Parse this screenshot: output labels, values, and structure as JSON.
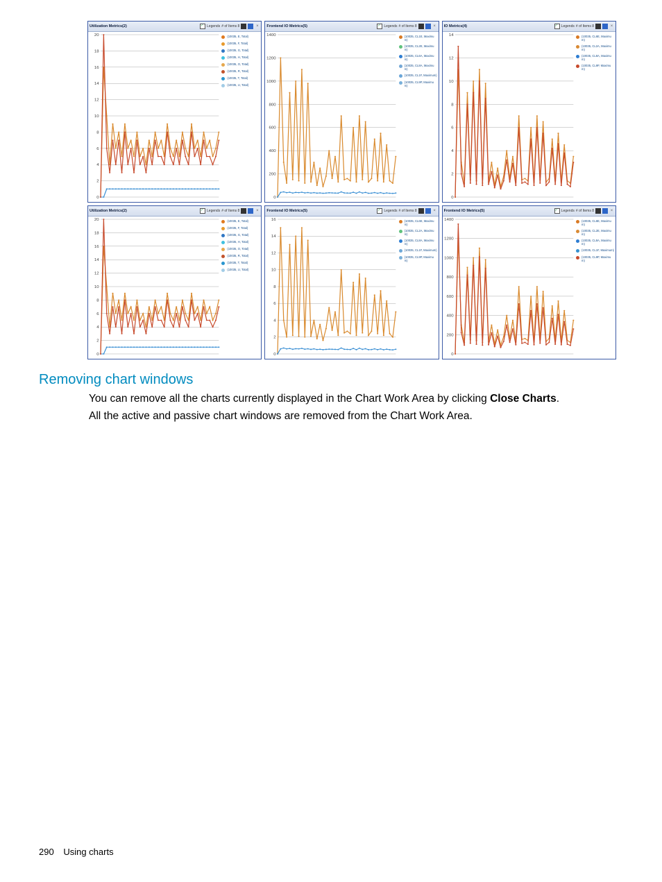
{
  "section_heading": "Removing chart windows",
  "paragraph_line1": "You can remove all the charts currently displayed in the Chart Work Area by clicking ",
  "paragraph_bold": "Close Charts",
  "paragraph_line1_end": ".",
  "paragraph_line2": "All the active and passive chart windows are removed from the Chart Work Area.",
  "footer_page": "290",
  "footer_label": "Using charts",
  "legends_label": "Legends",
  "items_label": "# of Items 8",
  "panels_row1": [
    {
      "title": "Utilization Metrics(2)",
      "ymax": 20,
      "yticks": [
        0,
        2,
        4,
        6,
        8,
        10,
        12,
        14,
        16,
        18,
        20
      ],
      "legends": [
        {
          "color": "#e07a1f",
          "label": "(10035, E, Total)"
        },
        {
          "color": "#e89a2c",
          "label": "(10035, F, Total)"
        },
        {
          "color": "#2f77c4",
          "label": "(10035, G, Total)"
        },
        {
          "color": "#3fc1e0",
          "label": "(10035, H, Total)"
        },
        {
          "color": "#e6a84e",
          "label": "(10035, O, Total)"
        },
        {
          "color": "#c2532c",
          "label": "(10035, R, Total)"
        },
        {
          "color": "#2996cf",
          "label": "(10035, T, Total)"
        },
        {
          "color": "#a2cce6",
          "label": "(10035, U, Total)"
        }
      ],
      "series": [
        {
          "color": "#d98a2e",
          "data": [
            0,
            16,
            10,
            4,
            9,
            6,
            8,
            5,
            9,
            6,
            7,
            5,
            8,
            5,
            6,
            4,
            7,
            5,
            8,
            6,
            7,
            5,
            9,
            6,
            5,
            7,
            5,
            8,
            6,
            5,
            9,
            6,
            7,
            5,
            8,
            6,
            7,
            5,
            6,
            8
          ]
        },
        {
          "color": "#3a8fd4",
          "data": [
            0,
            0,
            1,
            1,
            1,
            1,
            1,
            1,
            1,
            1,
            1,
            1,
            1,
            1,
            1,
            1,
            1,
            1,
            1,
            1,
            1,
            1,
            1,
            1,
            1,
            1,
            1,
            1,
            1,
            1,
            1,
            1,
            1,
            1,
            1,
            1,
            1,
            1,
            1,
            1
          ]
        },
        {
          "color": "#c74a2c",
          "data": [
            0,
            20,
            6,
            3,
            7,
            4,
            7,
            3,
            8,
            4,
            6,
            3,
            7,
            4,
            5,
            3,
            6,
            4,
            7,
            5,
            5,
            4,
            8,
            5,
            4,
            6,
            4,
            7,
            5,
            4,
            8,
            5,
            6,
            4,
            7,
            5,
            5,
            4,
            5,
            7
          ]
        }
      ]
    },
    {
      "title": "Frontend IO Metrics(5)",
      "ymax": 1400,
      "yticks": [
        0,
        200,
        400,
        600,
        800,
        1000,
        1200,
        1400
      ],
      "legends": [
        {
          "color": "#d97a24",
          "label": "(10035, CL1E, Maximum)"
        },
        {
          "color": "#5fc27d",
          "label": "(10035, CL2E, Maximum)"
        },
        {
          "color": "#2d7dd2",
          "label": "(10035, CL6A, Maximum)"
        },
        {
          "color": "#75a8d6",
          "label": "(10035, CL8A, Maximum)"
        },
        {
          "color": "#6aa6d8",
          "label": "(10035, CL1F, Maximum)"
        },
        {
          "color": "#79b0da",
          "label": "(10035, CL9P, Maximum)"
        }
      ],
      "series": [
        {
          "color": "#d98a2e",
          "data": [
            0,
            1200,
            300,
            120,
            900,
            150,
            1000,
            140,
            1100,
            120,
            980,
            130,
            300,
            100,
            250,
            90,
            180,
            400,
            160,
            350,
            130,
            700,
            150,
            160,
            140,
            600,
            130,
            700,
            150,
            650,
            130,
            160,
            500,
            140,
            550,
            130,
            450,
            140,
            120,
            350
          ]
        },
        {
          "color": "#3a8fd4",
          "data": [
            0,
            40,
            45,
            38,
            42,
            35,
            40,
            38,
            42,
            36,
            39,
            35,
            38,
            34,
            36,
            33,
            35,
            37,
            36,
            35,
            34,
            45,
            36,
            35,
            34,
            42,
            33,
            44,
            35,
            40,
            33,
            34,
            39,
            33,
            38,
            32,
            36,
            33,
            32,
            35
          ]
        }
      ]
    },
    {
      "title": "IO Metrics(4)",
      "ymax": 14,
      "yticks": [
        0,
        2,
        4,
        6,
        8,
        10,
        12,
        14
      ],
      "legends": [
        {
          "color": "#d97a24",
          "label": "(10035, CL6E, Maximum)"
        },
        {
          "color": "#d98a34",
          "label": "(10035, CL2A, Maximum)"
        },
        {
          "color": "#2d7dd2",
          "label": "(10035, CL8A, Maximum)"
        },
        {
          "color": "#c74a2c",
          "label": "(10035, CL9P, Maximum)"
        }
      ],
      "series": [
        {
          "color": "#d98a2e",
          "data": [
            0,
            11,
            3,
            1.2,
            9,
            1.5,
            10,
            1.4,
            11,
            1.2,
            9.8,
            1.3,
            3,
            1,
            2.5,
            0.9,
            1.8,
            4,
            1.6,
            3.5,
            1.3,
            7,
            1.5,
            1.6,
            1.4,
            6,
            1.3,
            7,
            1.5,
            6.5,
            1.3,
            1.6,
            5,
            1.4,
            5.5,
            1.3,
            4.5,
            1.4,
            1.2,
            3.5
          ]
        },
        {
          "color": "#c74a2c",
          "data": [
            0,
            13,
            2,
            0.9,
            8,
            1.2,
            9,
            1.1,
            10,
            1,
            8.5,
            1.1,
            2.2,
            0.8,
            1.9,
            0.7,
            1.4,
            3.2,
            1.3,
            2.9,
            1,
            6,
            1.2,
            1.3,
            1.1,
            5,
            1,
            6,
            1.2,
            5.5,
            1,
            1.3,
            4.2,
            1.1,
            4.6,
            1,
            3.8,
            1.1,
            0.9,
            3
          ]
        }
      ]
    }
  ],
  "panels_row2": [
    {
      "title": "Utilization Metrics(2)",
      "ymax": 20,
      "yticks": [
        0,
        2,
        4,
        6,
        8,
        10,
        12,
        14,
        16,
        18,
        20
      ],
      "legends": [
        {
          "color": "#e07a1f",
          "label": "(10035, E, Total)"
        },
        {
          "color": "#e89a2c",
          "label": "(10035, F, Total)"
        },
        {
          "color": "#2f77c4",
          "label": "(10035, G, Total)"
        },
        {
          "color": "#3fc1e0",
          "label": "(10035, H, Total)"
        },
        {
          "color": "#e6a84e",
          "label": "(10035, O, Total)"
        },
        {
          "color": "#c2532c",
          "label": "(10035, R, Total)"
        },
        {
          "color": "#2996cf",
          "label": "(10035, T, Total)"
        },
        {
          "color": "#a2cce6",
          "label": "(10035, U, Total)"
        }
      ],
      "series": [
        {
          "color": "#d98a2e",
          "data": [
            0,
            16,
            10,
            4,
            9,
            6,
            8,
            5,
            9,
            6,
            7,
            5,
            8,
            5,
            6,
            4,
            7,
            5,
            8,
            6,
            7,
            5,
            9,
            6,
            5,
            7,
            5,
            8,
            6,
            5,
            9,
            6,
            7,
            5,
            8,
            6,
            7,
            5,
            6,
            8
          ]
        },
        {
          "color": "#3a8fd4",
          "data": [
            0,
            0,
            1,
            1,
            1,
            1,
            1,
            1,
            1,
            1,
            1,
            1,
            1,
            1,
            1,
            1,
            1,
            1,
            1,
            1,
            1,
            1,
            1,
            1,
            1,
            1,
            1,
            1,
            1,
            1,
            1,
            1,
            1,
            1,
            1,
            1,
            1,
            1,
            1,
            1
          ]
        },
        {
          "color": "#c74a2c",
          "data": [
            0,
            20,
            6,
            3,
            7,
            4,
            7,
            3,
            8,
            4,
            6,
            3,
            7,
            4,
            5,
            3,
            6,
            4,
            7,
            5,
            5,
            4,
            8,
            5,
            4,
            6,
            4,
            7,
            5,
            4,
            8,
            5,
            6,
            4,
            7,
            5,
            5,
            4,
            5,
            7
          ]
        }
      ]
    },
    {
      "title": "Frontend IO Metrics(5)",
      "ymax": 16,
      "yticks": [
        0,
        2,
        4,
        6,
        8,
        10,
        12,
        14,
        16
      ],
      "legends": [
        {
          "color": "#d97a24",
          "label": "(10035, CL6E, Maximum)"
        },
        {
          "color": "#5fc27d",
          "label": "(10035, CL2A, Maximum)"
        },
        {
          "color": "#2d7dd2",
          "label": "(10035, CL8A, Maximum)"
        },
        {
          "color": "#6fa8d8",
          "label": "(10035, CL1F, Maximum)"
        },
        {
          "color": "#79b0da",
          "label": "(10035, CL9P, Maximum)"
        }
      ],
      "series": [
        {
          "color": "#d98a2e",
          "data": [
            0,
            15,
            4,
            2,
            13,
            2.2,
            14,
            2.1,
            15,
            2,
            13.5,
            2.1,
            4,
            1.8,
            3.5,
            1.6,
            3,
            5.5,
            2.8,
            5,
            2.2,
            10,
            2.5,
            2.7,
            2.4,
            8.5,
            2.2,
            9.5,
            2.5,
            9,
            2.2,
            2.7,
            7,
            2.4,
            7.5,
            2.2,
            6.3,
            2.4,
            2,
            5
          ]
        },
        {
          "color": "#3a8fd4",
          "data": [
            0,
            0.6,
            0.7,
            0.6,
            0.65,
            0.55,
            0.62,
            0.6,
            0.66,
            0.56,
            0.61,
            0.54,
            0.6,
            0.52,
            0.55,
            0.5,
            0.54,
            0.57,
            0.55,
            0.54,
            0.52,
            0.7,
            0.55,
            0.54,
            0.52,
            0.65,
            0.5,
            0.68,
            0.54,
            0.62,
            0.5,
            0.52,
            0.6,
            0.5,
            0.59,
            0.49,
            0.56,
            0.5,
            0.48,
            0.55
          ]
        }
      ]
    },
    {
      "title": "Frontend IO Metrics(5)",
      "ymax": 1400,
      "yticks": [
        0,
        200,
        400,
        600,
        800,
        1000,
        1200,
        1400
      ],
      "legends": [
        {
          "color": "#d97a24",
          "label": "(10035, CL6E, Maximum)"
        },
        {
          "color": "#d98a34",
          "label": "(10035, CL2E, Maximum)"
        },
        {
          "color": "#2d7dd2",
          "label": "(10035, CL8A, Maximum)"
        },
        {
          "color": "#3490d0",
          "label": "(10035, CL1F, Maximum)"
        },
        {
          "color": "#c74a2c",
          "label": "(10035, CL9P, Maximum)"
        }
      ],
      "series": [
        {
          "color": "#d98a2e",
          "data": [
            0,
            1200,
            300,
            120,
            900,
            150,
            1000,
            140,
            1100,
            120,
            980,
            130,
            300,
            100,
            250,
            90,
            180,
            400,
            160,
            350,
            130,
            700,
            150,
            160,
            140,
            600,
            130,
            700,
            150,
            650,
            130,
            160,
            500,
            140,
            550,
            130,
            450,
            140,
            120,
            350
          ]
        },
        {
          "color": "#c74a2c",
          "data": [
            0,
            1350,
            220,
            90,
            820,
            110,
            920,
            100,
            1010,
            90,
            890,
            95,
            220,
            75,
            185,
            68,
            130,
            300,
            120,
            260,
            95,
            520,
            110,
            120,
            100,
            450,
            95,
            520,
            110,
            480,
            95,
            120,
            370,
            100,
            410,
            95,
            335,
            100,
            88,
            260
          ]
        }
      ]
    }
  ]
}
